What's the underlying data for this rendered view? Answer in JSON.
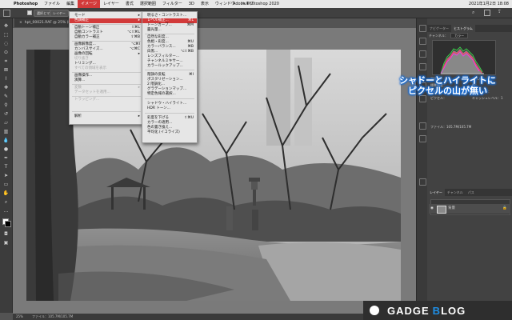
{
  "menubar": {
    "apple": "",
    "app_name": "Photoshop",
    "items": [
      "ファイル",
      "編集",
      "イメージ",
      "レイヤー",
      "書式",
      "選択範囲",
      "フィルター",
      "3D",
      "表示",
      "ウィンドウ",
      "ヘルプ"
    ],
    "active_index": 2,
    "window_title": "Adobe Photoshop 2020",
    "clock": "2021年1月2日 18:08"
  },
  "options_bar": {
    "buttons": [
      "選択とマスク...",
      "レイヤー"
    ]
  },
  "document": {
    "tab_label": "hpt_00021.RAF @ 25% (RGB/16)",
    "status_zoom": "25%",
    "status_file": "ファイル：105.7M/105.7M"
  },
  "image_menu": {
    "items": [
      {
        "label": "モード",
        "shortcut": "▸",
        "state": "normal"
      },
      {
        "label": "色調補正",
        "shortcut": "▸",
        "state": "highlight"
      },
      {
        "label": "自動トーン補正",
        "shortcut": "⇧⌘L",
        "state": "normal"
      },
      {
        "label": "自動コントラスト",
        "shortcut": "⌥⇧⌘L",
        "state": "normal"
      },
      {
        "label": "自動カラー補正",
        "shortcut": "⇧⌘B",
        "state": "normal"
      },
      {
        "label": "画像解像度...",
        "shortcut": "⌥⌘I",
        "state": "normal"
      },
      {
        "label": "カンバスサイズ...",
        "shortcut": "⌥⌘C",
        "state": "normal"
      },
      {
        "label": "画像の回転",
        "shortcut": "▸",
        "state": "normal"
      },
      {
        "label": "切り抜き",
        "shortcut": "",
        "state": "disabled"
      },
      {
        "label": "トリミング...",
        "shortcut": "",
        "state": "normal"
      },
      {
        "label": "すべての領域を表示",
        "shortcut": "",
        "state": "disabled"
      },
      {
        "label": "画像操作...",
        "shortcut": "",
        "state": "normal"
      },
      {
        "label": "演算...",
        "shortcut": "",
        "state": "normal"
      },
      {
        "label": "変数",
        "shortcut": "▸",
        "state": "disabled"
      },
      {
        "label": "データセットを適用...",
        "shortcut": "",
        "state": "disabled"
      },
      {
        "label": "トラッピング...",
        "shortcut": "",
        "state": "disabled"
      },
      {
        "label": "解析",
        "shortcut": "▸",
        "state": "normal"
      }
    ]
  },
  "adjust_menu": {
    "items": [
      {
        "label": "明るさ・コントラスト...",
        "shortcut": "",
        "state": "normal"
      },
      {
        "label": "レベル補正...",
        "shortcut": "⌘L",
        "state": "highlight"
      },
      {
        "label": "トーンカーブ...",
        "shortcut": "⌘M",
        "state": "normal"
      },
      {
        "label": "露光量...",
        "shortcut": "",
        "state": "normal"
      },
      {
        "label": "自然な彩度...",
        "shortcut": "",
        "state": "normal"
      },
      {
        "label": "色相・彩度...",
        "shortcut": "⌘U",
        "state": "normal"
      },
      {
        "label": "カラーバランス...",
        "shortcut": "⌘B",
        "state": "normal"
      },
      {
        "label": "白黒...",
        "shortcut": "⌥⇧⌘B",
        "state": "normal"
      },
      {
        "label": "レンズフィルター...",
        "shortcut": "",
        "state": "normal"
      },
      {
        "label": "チャンネルミキサー...",
        "shortcut": "",
        "state": "normal"
      },
      {
        "label": "カラールックアップ...",
        "shortcut": "",
        "state": "normal"
      },
      {
        "label": "階調の反転",
        "shortcut": "⌘I",
        "state": "normal"
      },
      {
        "label": "ポスタリゼーション...",
        "shortcut": "",
        "state": "normal"
      },
      {
        "label": "2 階調化...",
        "shortcut": "",
        "state": "normal"
      },
      {
        "label": "グラデーションマップ...",
        "shortcut": "",
        "state": "normal"
      },
      {
        "label": "特定色域の選択...",
        "shortcut": "",
        "state": "normal"
      },
      {
        "label": "シャドウ・ハイライト...",
        "shortcut": "",
        "state": "normal"
      },
      {
        "label": "HDR トーン...",
        "shortcut": "",
        "state": "normal"
      },
      {
        "label": "彩度を下げる",
        "shortcut": "⇧⌘U",
        "state": "normal"
      },
      {
        "label": "カラーの適用...",
        "shortcut": "",
        "state": "normal"
      },
      {
        "label": "色の置き換え...",
        "shortcut": "",
        "state": "normal"
      },
      {
        "label": "平均化 (イコライズ)",
        "shortcut": "",
        "state": "normal"
      }
    ]
  },
  "histogram_panel": {
    "tabs": [
      "ナビゲーター",
      "ヒストグラム"
    ],
    "active_tab": 1,
    "channel_label": "チャンネル：",
    "channel_value": "カラー",
    "stats_left": [
      "平均値：",
      "標準偏差：",
      "中間値：",
      "ピクセル："
    ],
    "stats_left_values": [
      "",
      "",
      "",
      ""
    ],
    "stats_right": [
      "レベル：",
      "数：",
      "パーセント：",
      "キャッシュレベル："
    ],
    "stats_right_values": [
      "",
      "",
      "",
      "1"
    ],
    "source_label": "ファイル：105.7M/105.7M"
  },
  "layers_panel": {
    "tabs": [
      "レイヤー",
      "チャンネル",
      "パス"
    ],
    "active_tab": 0,
    "layer_name": "背景"
  },
  "callout": {
    "line1": "シャドーとハイライトに",
    "line2": "ピクセルの山が無い"
  },
  "logo": {
    "part1": "GADGE",
    "b_letter": "B",
    "part2": "LOG"
  },
  "colors": {
    "accent_menu": "#d23a3a",
    "callout_glow": "#1b6fd6",
    "logo_blue": "#1f8fe6",
    "histogram_red": "#ff3b5a",
    "histogram_green": "#3ad14a",
    "histogram_magenta": "#e046e0"
  }
}
